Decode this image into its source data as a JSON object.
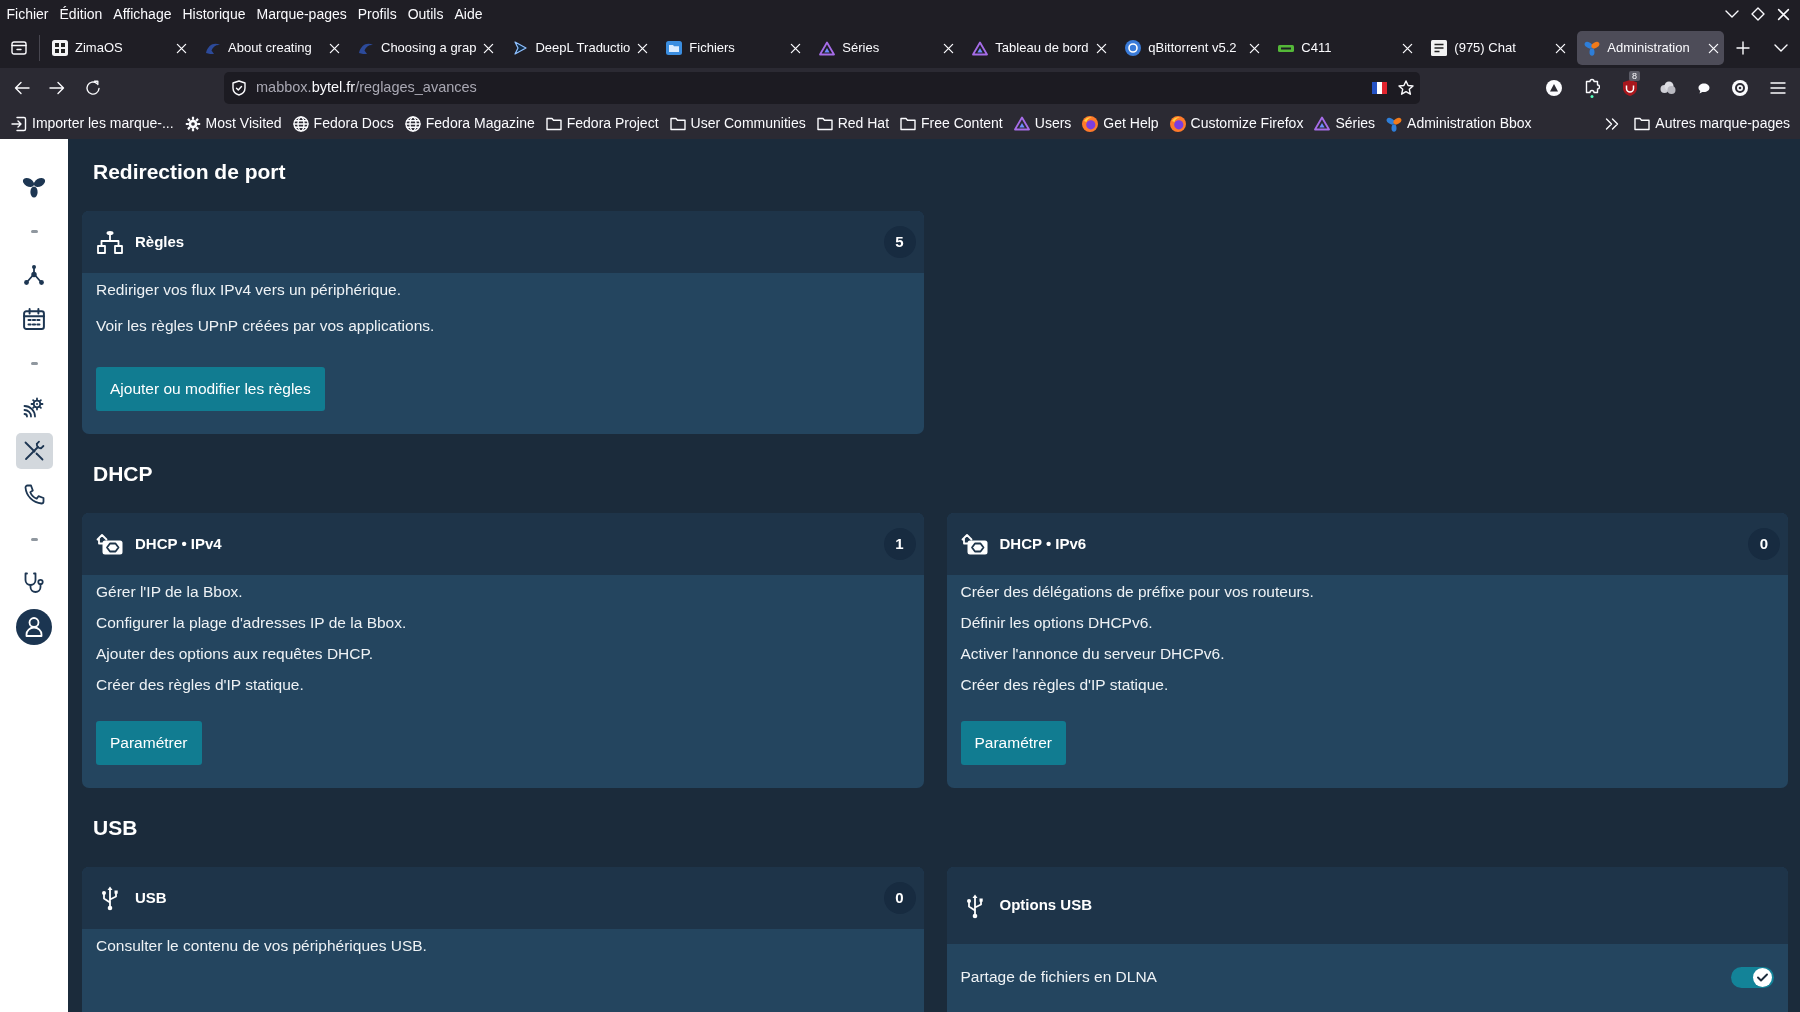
{
  "menu_bar": {
    "items": [
      "Fichier",
      "Édition",
      "Affichage",
      "Historique",
      "Marque-pages",
      "Profils",
      "Outils",
      "Aide"
    ]
  },
  "tabs": [
    {
      "title": "ZimaOS",
      "selected": false
    },
    {
      "title": "About creating",
      "selected": false
    },
    {
      "title": "Choosing a grap",
      "selected": false
    },
    {
      "title": "DeepL Traductio",
      "selected": false
    },
    {
      "title": "Fichiers",
      "selected": false
    },
    {
      "title": "Séries",
      "selected": false
    },
    {
      "title": "Tableau de bord",
      "selected": false
    },
    {
      "title": "qBittorrent v5.2",
      "selected": false
    },
    {
      "title": "C411",
      "selected": false
    },
    {
      "title": "(975) Chat",
      "selected": false
    },
    {
      "title": "Administration",
      "selected": true
    }
  ],
  "address_bar": {
    "url": {
      "subdomain": "mabbox.",
      "domain": "bytel.fr",
      "path": "/reglages_avances"
    }
  },
  "toolbar": {
    "extension_badge": "8"
  },
  "bookmarks": {
    "items": [
      "Importer les marque-...",
      "Most Visited",
      "Fedora Docs",
      "Fedora Magazine",
      "Fedora Project",
      "User Communities",
      "Red Hat",
      "Free Content",
      "Users",
      "Get Help",
      "Customize Firefox",
      "Séries",
      "Administration Bbox"
    ],
    "other": "Autres marque-pages"
  },
  "sidebar": {
    "items": [
      {
        "kind": "logo"
      },
      {
        "kind": "separator"
      },
      {
        "kind": "link",
        "selected": false
      },
      {
        "kind": "link",
        "selected": false
      },
      {
        "kind": "separator"
      },
      {
        "kind": "link",
        "selected": false
      },
      {
        "kind": "link",
        "selected": true
      },
      {
        "kind": "link",
        "selected": false
      },
      {
        "kind": "separator"
      },
      {
        "kind": "link",
        "selected": false
      },
      {
        "kind": "account",
        "selected": false
      }
    ]
  },
  "sections": [
    {
      "title": "Redirection de port",
      "cards": [
        {
          "title": "Règles",
          "count": "5",
          "paragraphs": [
            "Rediriger vos flux IPv4 vers un périphérique.",
            "Voir les règles UPnP créées par vos applications."
          ],
          "button": "Ajouter ou modifier les règles"
        }
      ]
    },
    {
      "title": "DHCP",
      "cards": [
        {
          "title": "DHCP • IPv4",
          "count": "1",
          "lines": [
            "Gérer l'IP de la Bbox.",
            "Configurer la plage d'adresses IP de la Bbox.",
            "Ajouter des options aux requêtes DHCP.",
            "Créer des règles d'IP statique."
          ],
          "button": "Paramétrer"
        },
        {
          "title": "DHCP • IPv6",
          "count": "0",
          "lines": [
            "Créer des délégations de préfixe pour vos routeurs.",
            "Définir les options DHCPv6.",
            "Activer l'annonce du serveur DHCPv6.",
            "Créer des règles d'IP statique."
          ],
          "button": "Paramétrer"
        }
      ]
    },
    {
      "title": "USB",
      "cards": [
        {
          "title": "USB",
          "count": "0",
          "lines": [
            "Consulter le contenu de vos périphériques USB."
          ]
        },
        {
          "title": "Options USB",
          "options": [
            {
              "label": "Partage de fichiers en DLNA",
              "on": true
            }
          ]
        }
      ]
    }
  ]
}
